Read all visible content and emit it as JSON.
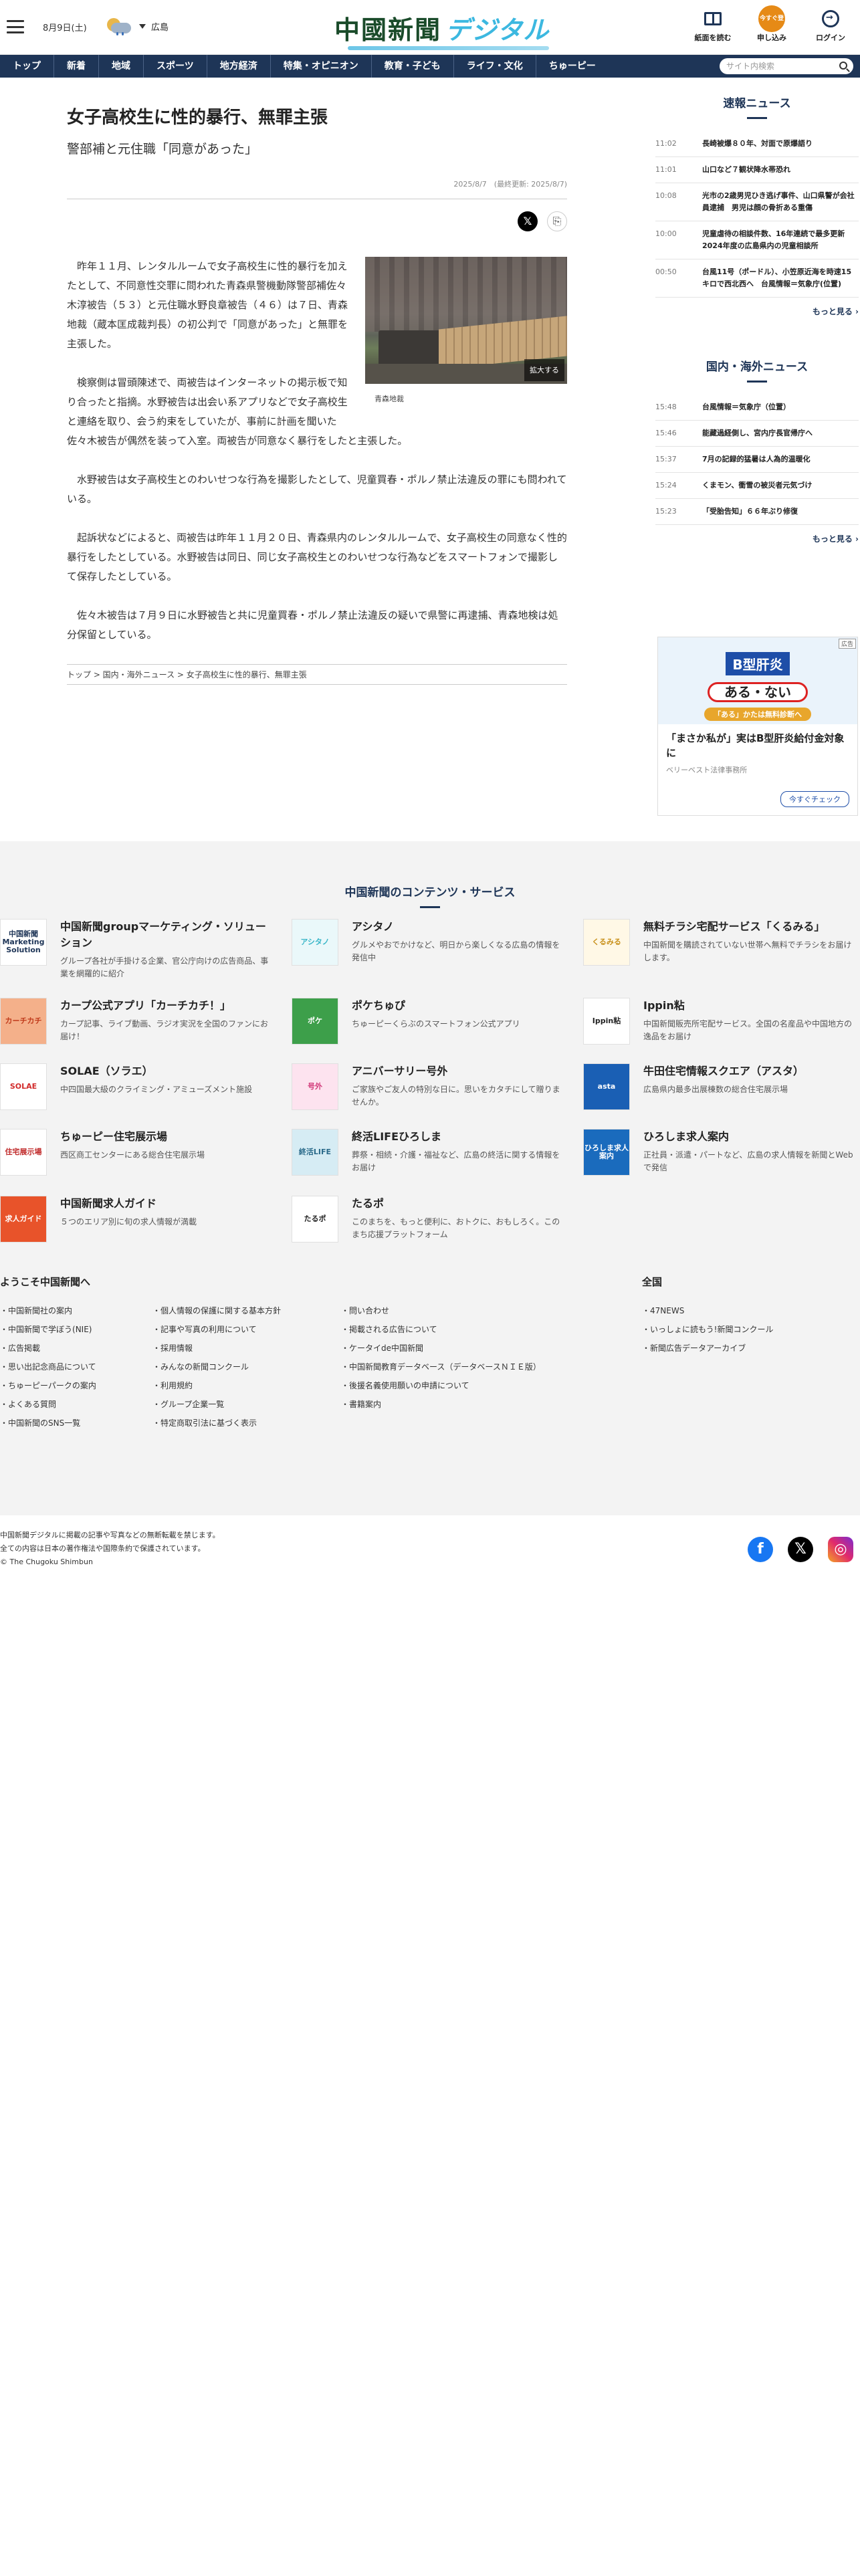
{
  "header": {
    "date": "8月9日(土)",
    "region": "広島",
    "logo_main": "中國新聞",
    "logo_sub": "デジタル",
    "buttons": [
      {
        "label": "紙面を読む",
        "icon": "book-icon"
      },
      {
        "label": "申し込み",
        "icon": "subscribe-icon",
        "badge": "今すぐ登録"
      },
      {
        "label": "ログイン",
        "icon": "login-icon"
      }
    ]
  },
  "nav": {
    "items": [
      "トップ",
      "新着",
      "地域",
      "スポーツ",
      "地方経済",
      "特集・オピニオン",
      "教育・子ども",
      "ライフ・文化",
      "ちゅーピー"
    ],
    "search_placeholder": "サイト内検索"
  },
  "article": {
    "title": "女子高校生に性的暴行、無罪主張",
    "subtitle": "警部補と元住職「同意があった」",
    "date": "2025/8/7　(最終更新: 2025/8/7)",
    "photo_caption": "青森地裁",
    "photo_enlarge": "拡大する",
    "paragraphs": [
      "昨年１１月、レンタルルームで女子高校生に性的暴行を加えたとして、不同意性交罪に問われた青森県警機動隊警部補佐々木淳被告（５３）と元住職水野良章被告（４６）は７日、青森地裁（蔵本匡成裁判長）の初公判で「同意があった」と無罪を主張した。",
      "検察側は冒頭陳述で、両被告はインターネットの掲示板で知り合ったと指摘。水野被告は出会い系アプリなどで女子高校生と連絡を取り、会う約束をしていたが、事前に計画を聞いた佐々木被告が偶然を装って入室。両被告が同意なく暴行をしたと主張した。",
      "水野被告は女子高校生とのわいせつな行為を撮影したとして、児童買春・ポルノ禁止法違反の罪にも問われている。",
      "起訴状などによると、両被告は昨年１１月２０日、青森県内のレンタルルームで、女子高校生の同意なく性的暴行をしたとしている。水野被告は同日、同じ女子高校生とのわいせつな行為などをスマートフォンで撮影して保存したとしている。",
      "佐々木被告は７月９日に水野被告と共に児童買春・ポルノ禁止法違反の疑いで県警に再逮捕、青森地検は処分保留としている。"
    ],
    "breadcrumb": "トップ > 国内・海外ニュース > 女子高校生に性的暴行、無罪主張"
  },
  "sidebar": {
    "breaking_title": "速報ニュース",
    "breaking": [
      {
        "time": "11:02",
        "text": "長崎被爆８０年、対面で原爆語り"
      },
      {
        "time": "11:01",
        "text": "山口など７観状降水帯恐れ"
      },
      {
        "time": "10:08",
        "text": "光市の2歳男児ひき逃げ事件、山口県警が会社員逮捕　男児は顔の骨折ある重傷"
      },
      {
        "time": "10:00",
        "text": "児童虐待の相談件数、16年連続で最多更新　2024年度の広島県内の児童相談所"
      },
      {
        "time": "00:50",
        "text": "台風11号（ポードル）、小笠原近海を時速15キロで西北西へ　台風情報＝気象庁(位置)"
      }
    ],
    "more1": "もっと見る",
    "world_title": "国内・海外ニュース",
    "world": [
      {
        "time": "15:48",
        "text": "台風情報＝気象庁（位置）"
      },
      {
        "time": "15:46",
        "text": "能藏過経側し、宮内庁長官帰庁へ"
      },
      {
        "time": "15:37",
        "text": "7月の記録的猛暑は人為的温暖化"
      },
      {
        "time": "15:24",
        "text": "くまモン、衝雪の被災者元気づけ"
      },
      {
        "time": "15:23",
        "text": "「受胎告知」６６年ぶり修復"
      }
    ],
    "more2": "もっと見る",
    "ad": {
      "badge": "広告",
      "banner": "B型肝炎",
      "banner_small": "ある・ない",
      "banner_pill": "「ある」かたは無料診断へ",
      "title": "「まさか私が」実はB型肝炎給付金対象に",
      "sponsor": "ベリーベスト法律事務所",
      "cta": "今すぐチェック"
    }
  },
  "contents": {
    "title": "中国新聞のコンテンツ・サービス",
    "items": [
      {
        "name": "中国新聞groupマーケティング・ソリューション",
        "desc": "グループ各社が手掛ける企業、官公庁向けの広告商品、事業を網羅的に紹介",
        "logo": "中国新聞 Marketing Solution",
        "logo_bg": "#ffffff",
        "logo_fg": "#1e3557"
      },
      {
        "name": "アシタノ",
        "desc": "グルメやおでかけなど、明日から楽しくなる広島の情報を発信中",
        "logo": "アシタノ",
        "logo_bg": "#eaf8fa",
        "logo_fg": "#3ab6c8"
      },
      {
        "name": "無料チラシ宅配サービス「くるみる」",
        "desc": "中国新聞を購読されていない世帯へ無料でチラシをお届けします。",
        "logo": "くるみる",
        "logo_bg": "#fff8e6",
        "logo_fg": "#c8901a"
      },
      {
        "name": "カープ公式アプリ「カーチカチ！」",
        "desc": "カープ記事、ライブ動画、ラジオ実況を全国のファンにお届け！",
        "logo": "カーチカチ",
        "logo_bg": "#f4b08a",
        "logo_fg": "#c03a1a"
      },
      {
        "name": "ポケちゅぴ",
        "desc": "ちゅーピーくらぶのスマートフォン公式アプリ",
        "logo": "ポケ",
        "logo_bg": "#3d9f4a",
        "logo_fg": "#ffffff"
      },
      {
        "name": "Ippin粘",
        "desc": "中国新聞販売所宅配サービス。全国の名産品や中国地方の逸品をお届け",
        "logo": "Ippin粘",
        "logo_bg": "#ffffff",
        "logo_fg": "#222222"
      },
      {
        "name": "SOLAE（ソラエ）",
        "desc": "中四国最大級のクライミング・アミューズメント施設",
        "logo": "SOLAE",
        "logo_bg": "#ffffff",
        "logo_fg": "#d12a2a"
      },
      {
        "name": "アニバーサリー号外",
        "desc": "ご家族やご友人の特別な日に。思いをカタチにして贈りませんか。",
        "logo": "号外",
        "logo_bg": "#fde3ef",
        "logo_fg": "#d23a7a"
      },
      {
        "name": "牛田住宅情報スクエア（アスタ）",
        "desc": "広島県内最多出展棟数の総合住宅展示場",
        "logo": "asta",
        "logo_bg": "#1a5fb4",
        "logo_fg": "#ffffff"
      },
      {
        "name": "ちゅーピー住宅展示場",
        "desc": "西区商工センターにある総合住宅展示場",
        "logo": "住宅展示場",
        "logo_bg": "#ffffff",
        "logo_fg": "#c02a2a"
      },
      {
        "name": "終活LIFEひろしま",
        "desc": "葬祭・相続・介護・福祉など、広島の終活に関する情報をお届け",
        "logo": "終活LIFE",
        "logo_bg": "#d6ecf4",
        "logo_fg": "#2a6a8a"
      },
      {
        "name": "ひろしま求人案内",
        "desc": "正社員・派遣・パートなど、広島の求人情報を新聞とWebで発信",
        "logo": "ひろしま求人案内",
        "logo_bg": "#1a6bbd",
        "logo_fg": "#ffffff"
      },
      {
        "name": "中国新聞求人ガイド",
        "desc": "５つのエリア別に旬の求人情報が満載",
        "logo": "求人ガイド",
        "logo_bg": "#e8532a",
        "logo_fg": "#ffffff"
      },
      {
        "name": "たるポ",
        "desc": "このまちを、もっと便利に、おトクに、おもしろく。このまち応援プラットフォーム",
        "logo": "たるポ",
        "logo_bg": "#ffffff",
        "logo_fg": "#222222"
      }
    ]
  },
  "welcome": {
    "title": "ようこそ中国新聞へ",
    "col1": [
      "中国新聞社の案内",
      "中国新聞で学ぼう(NIE)",
      "広告掲載",
      "思い出記念商品について",
      "ちゅーピーパークの案内",
      "よくある質問",
      "中国新聞のSNS一覧"
    ],
    "col2": [
      "個人情報の保護に関する基本方針",
      "記事や写真の利用について",
      "採用情報",
      "みんなの新聞コンクール",
      "利用規約",
      "グループ企業一覧",
      "特定商取引法に基づく表示"
    ],
    "col3": [
      "問い合わせ",
      "掲載される広告について",
      "ケータイde中国新聞",
      "中国新聞教育データベース（データベースＮＩＥ版）",
      "後援名義使用願いの申請について",
      "書籍案内"
    ],
    "national_title": "全国",
    "col4": [
      "47NEWS",
      "いっしょに読もう!新聞コンクール",
      "新聞広告データアーカイブ"
    ]
  },
  "footer": {
    "copy1": "中国新聞デジタルに掲載の記事や写真などの無断転載を禁じます。",
    "copy2": "全ての内容は日本の著作権法や国際条約で保護されています。",
    "copy3": "© The Chugoku Shimbun",
    "social": [
      "facebook-icon",
      "x-icon",
      "instagram-icon"
    ]
  }
}
